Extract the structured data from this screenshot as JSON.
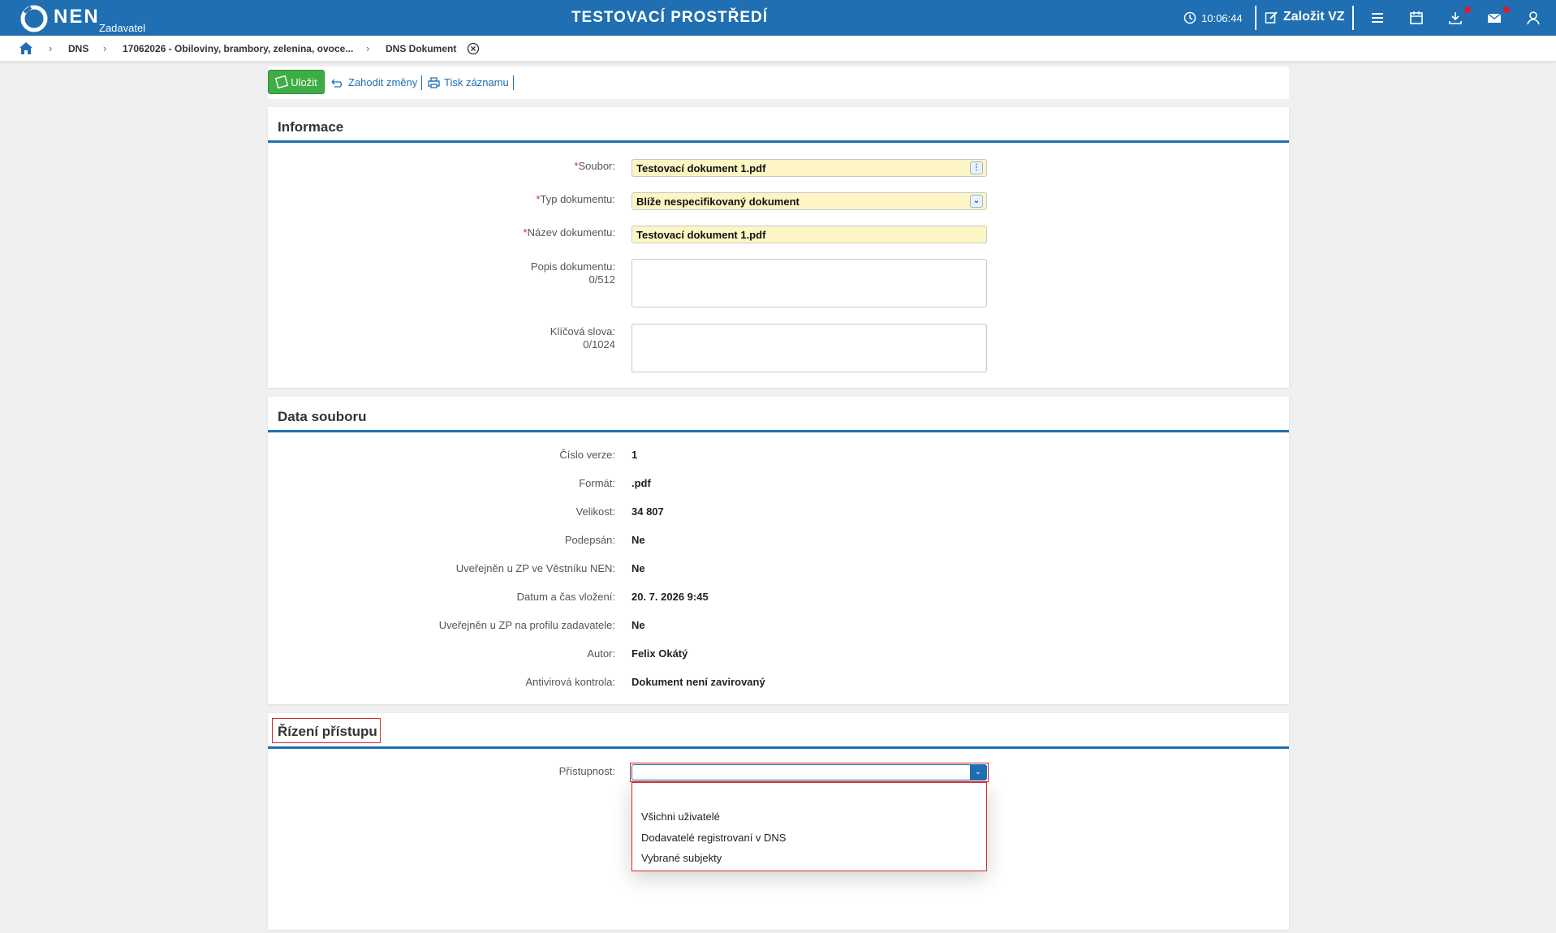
{
  "header": {
    "logo_text": "NEN",
    "logo_sub": "Zadavatel",
    "environment": "TESTOVACÍ PROSTŘEDÍ",
    "clock": "10:06:44",
    "create_label": "Založit VZ",
    "icons": [
      "clock-icon",
      "edit-icon",
      "menu-icon",
      "calendar-icon",
      "download-icon",
      "mail-icon",
      "user-icon"
    ]
  },
  "breadcrumb": {
    "items": [
      "DNS",
      "17062026 - Obiloviny, brambory, zelenina, ovoce...",
      "DNS Dokument"
    ]
  },
  "toolbar": {
    "save_label": "Uložit",
    "discard_label": "Zahodit změny",
    "print_label": "Tisk záznamu"
  },
  "informace": {
    "title": "Informace",
    "soubor_label": "Soubor:",
    "soubor_value": "Testovací dokument 1.pdf",
    "typ_label": "Typ dokumentu:",
    "typ_value": "Blíže nespecifikovaný dokument",
    "nazev_label": "Název dokumentu:",
    "nazev_value": "Testovací dokument 1.pdf",
    "popis_label": "Popis dokumentu:",
    "popis_counter": "0/512",
    "klicova_label": "Klíčová slova:",
    "klicova_counter": "0/1024"
  },
  "data_souboru": {
    "title": "Data souboru",
    "rows": [
      {
        "label": "Číslo verze:",
        "value": "1"
      },
      {
        "label": "Formát:",
        "value": ".pdf"
      },
      {
        "label": "Velikost:",
        "value": "34 807"
      },
      {
        "label": "Podepsán:",
        "value": "Ne"
      },
      {
        "label": "Uveřejněn u ZP ve Věstníku NEN:",
        "value": "Ne"
      },
      {
        "label": "Datum a čas vložení:",
        "value": "20. 7. 2026 9:45"
      },
      {
        "label": "Uveřejněn u ZP na profilu zadavatele:",
        "value": "Ne"
      },
      {
        "label": "Autor:",
        "value": "Felix Okátý"
      },
      {
        "label": "Antivirová kontrola:",
        "value": "Dokument není zavirovaný"
      }
    ]
  },
  "rizeni": {
    "title": "Řízení přístupu",
    "pristupnost_label": "Přístupnost:",
    "options": [
      "",
      "Všichni uživatelé",
      "Dodavatelé registrovaní v DNS",
      "Vybrané subjekty"
    ]
  },
  "colors": {
    "brand_blue": "#1f6fb2",
    "save_green": "#3fad46",
    "required_field": "#fdf6c4",
    "highlight_red": "#d52b2b"
  }
}
